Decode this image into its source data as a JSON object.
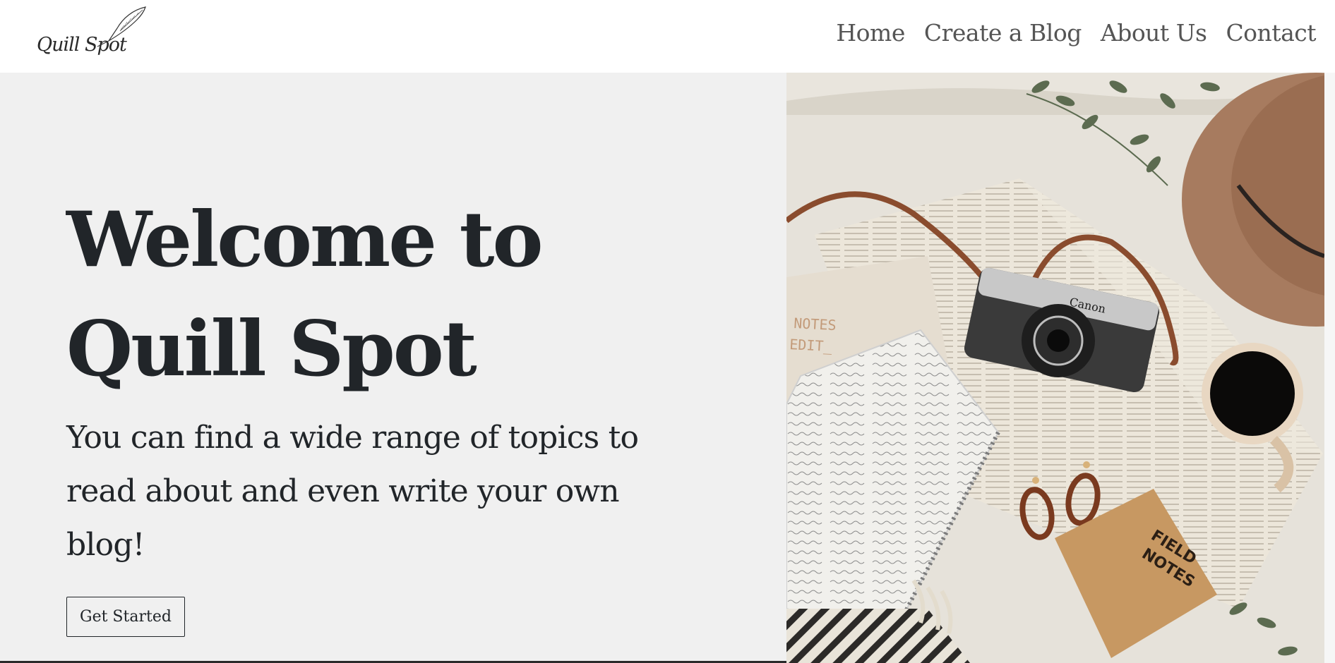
{
  "logo": {
    "text": "Quill Spot"
  },
  "nav": {
    "items": [
      {
        "label": "Home"
      },
      {
        "label": "Create a Blog"
      },
      {
        "label": "About Us"
      },
      {
        "label": "Contact"
      }
    ]
  },
  "hero": {
    "title_line1": "Welcome to",
    "title_line2": "Quill Spot",
    "subtitle": "You can find a wide range of topics to read about and even write your own blog!",
    "cta_label": "Get Started",
    "photo_text": {
      "notes_label_line1": "NOTES",
      "notes_label_line2": "EDIT_",
      "camera_brand": "Canon",
      "field_notes_line1": "FIELD",
      "field_notes_line2": "NOTES"
    }
  },
  "colors": {
    "hero_bg": "#f0f0f0",
    "text_dark": "#212529",
    "nav_text": "#555555"
  }
}
